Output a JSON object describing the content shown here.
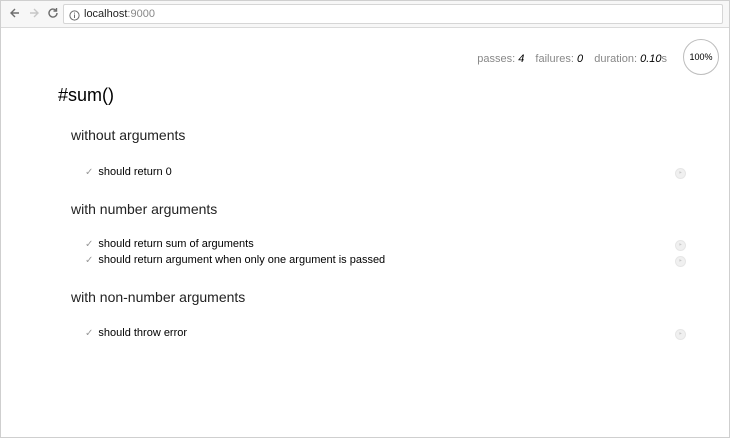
{
  "browser": {
    "url_host": "localhost",
    "url_port": ":9000",
    "icons": {
      "back": "back-arrow-icon",
      "forward": "forward-arrow-icon",
      "reload": "reload-icon",
      "info": "info-icon"
    }
  },
  "stats": {
    "passes_label": "passes:",
    "passes_value": "4",
    "failures_label": "failures:",
    "failures_value": "0",
    "duration_label": "duration:",
    "duration_value": "0.10",
    "duration_unit": "s",
    "progress_label": "100%",
    "progress_fraction": 1.0
  },
  "report": {
    "suite_title": "#sum()",
    "suites": [
      {
        "title": "without arguments",
        "tests": [
          {
            "title": "should return 0",
            "status": "pass"
          }
        ]
      },
      {
        "title": "with number arguments",
        "tests": [
          {
            "title": "should return sum of arguments",
            "status": "pass"
          },
          {
            "title": "should return argument when only one argument is passed",
            "status": "pass"
          }
        ]
      },
      {
        "title": "with non-number arguments",
        "tests": [
          {
            "title": "should throw error",
            "status": "pass"
          }
        ]
      }
    ],
    "check_glyph": "✓",
    "replay_glyph": "‣"
  },
  "colors": {
    "pass_check": "#9a9a9a",
    "stats_label": "#888888",
    "border": "#cfcfcf"
  }
}
